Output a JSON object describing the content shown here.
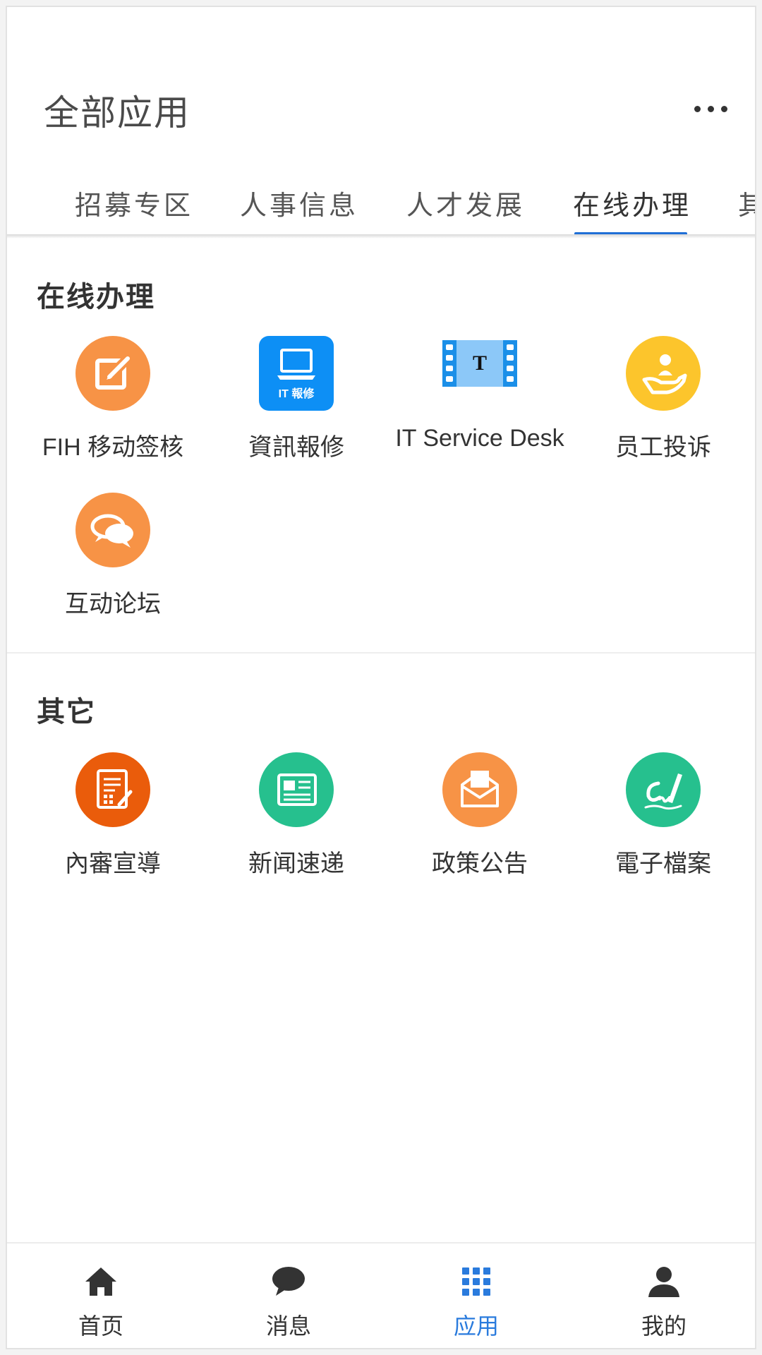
{
  "header": {
    "title": "全部应用",
    "more_icon": "more-horizontal-icon"
  },
  "tabs": [
    {
      "label": "招募专区",
      "active": false
    },
    {
      "label": "人事信息",
      "active": false
    },
    {
      "label": "人才发展",
      "active": false
    },
    {
      "label": "在线办理",
      "active": true
    },
    {
      "label": "其",
      "active": false
    }
  ],
  "sections": [
    {
      "title": "在线办理",
      "apps": [
        {
          "label": "FIH 移动签核",
          "icon": "edit-icon",
          "color": "#f79346"
        },
        {
          "label": "資訊報修",
          "icon": "laptop-repair-icon",
          "icon_text": "IT 報修",
          "color": "#0d8ff5"
        },
        {
          "label": "IT Service Desk",
          "icon": "film-t-icon",
          "icon_text": "T",
          "color": "#6fb6f5"
        },
        {
          "label": "员工投诉",
          "icon": "hand-person-icon",
          "color": "#fcc52c"
        },
        {
          "label": "互动论坛",
          "icon": "chat-bubbles-icon",
          "color": "#f79346"
        }
      ]
    },
    {
      "title": "其它",
      "apps": [
        {
          "label": "內審宣導",
          "icon": "document-pen-icon",
          "color": "#ea5c0b"
        },
        {
          "label": "新闻速递",
          "icon": "newspaper-icon",
          "color": "#26c08e"
        },
        {
          "label": "政策公告",
          "icon": "envelope-open-icon",
          "color": "#f79346"
        },
        {
          "label": "電子檔案",
          "icon": "signature-pen-icon",
          "color": "#26c08e"
        }
      ]
    }
  ],
  "bottom_nav": [
    {
      "label": "首页",
      "icon": "home-icon",
      "active": false
    },
    {
      "label": "消息",
      "icon": "message-icon",
      "active": false
    },
    {
      "label": "应用",
      "icon": "apps-grid-icon",
      "active": true
    },
    {
      "label": "我的",
      "icon": "user-icon",
      "active": false
    }
  ],
  "colors": {
    "accent": "#2a7bdd",
    "tab_underline": "#1f6fd6"
  }
}
